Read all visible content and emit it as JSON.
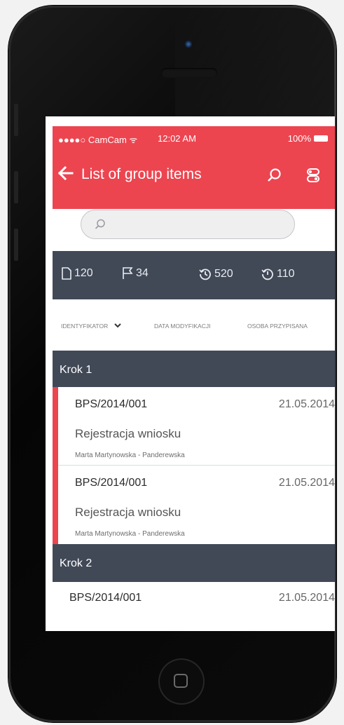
{
  "status_bar": {
    "carrier": "●●●●○ CamCam ᯤ",
    "time": "12:02 AM",
    "battery": "100%"
  },
  "header": {
    "back_icon": "arrow-left-icon",
    "title": "List of group items"
  },
  "search": {
    "placeholder": "",
    "value": ""
  },
  "stats": [
    {
      "icon": "document-icon",
      "value": "120"
    },
    {
      "icon": "flag-icon",
      "value": "34"
    },
    {
      "icon": "history-icon",
      "value": "520"
    },
    {
      "icon": "history-icon",
      "value": "110"
    }
  ],
  "sort": {
    "col1": "IDENTYFIKATOR",
    "col2": "DATA MODYFIKACJI",
    "col3": "OSOBA PRZYPISANA"
  },
  "groups": [
    {
      "label": "Krok 1",
      "items": [
        {
          "code": "BPS/2014/001",
          "date": "21.05.2014",
          "name": "Rejestracja wniosku",
          "person": "Marta Martynowska - Panderewska"
        },
        {
          "code": "BPS/2014/001",
          "date": "21.05.2014",
          "name": "Rejestracja wniosku",
          "person": "Marta Martynowska - Panderewska"
        }
      ]
    },
    {
      "label": "Krok 2",
      "items": [
        {
          "code": "BPS/2014/001",
          "date": "21.05.2014"
        }
      ]
    }
  ],
  "colors": {
    "accent": "#ec4550",
    "dark_bar": "#414957"
  }
}
